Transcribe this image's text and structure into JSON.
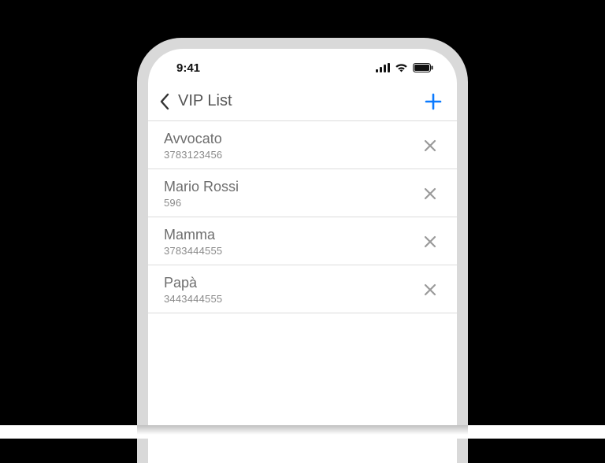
{
  "status": {
    "time": "9:41"
  },
  "nav": {
    "title": "VIP List"
  },
  "colors": {
    "accent": "#0a7aff",
    "muted": "#8a8a8a"
  },
  "contacts": [
    {
      "name": "Avvocato",
      "number": "3783123456"
    },
    {
      "name": "Mario Rossi",
      "number": "596"
    },
    {
      "name": "Mamma",
      "number": "3783444555"
    },
    {
      "name": "Papà",
      "number": "3443444555"
    }
  ]
}
